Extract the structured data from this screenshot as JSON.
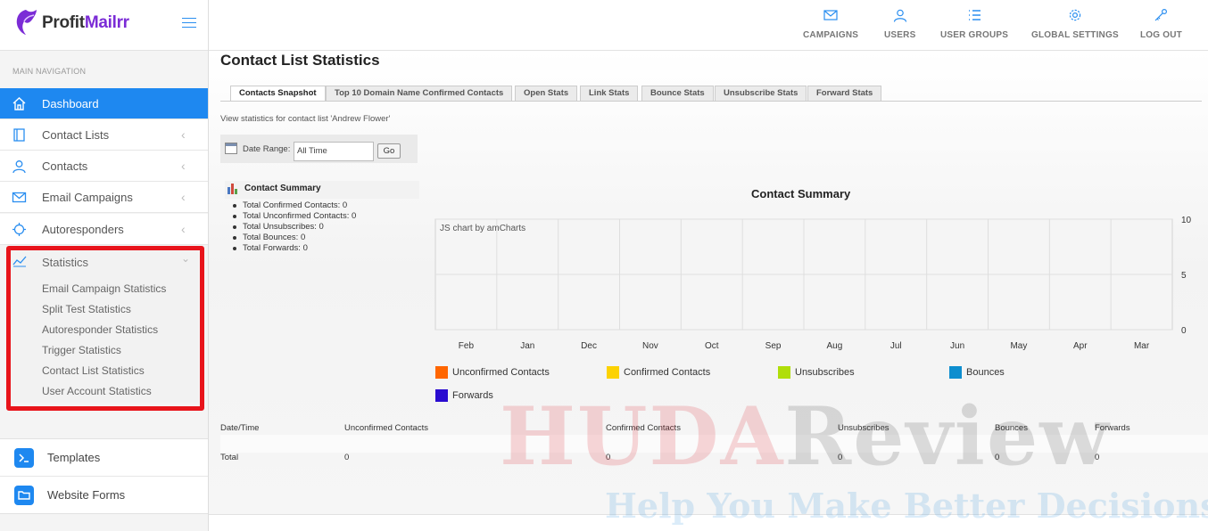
{
  "brand": {
    "part1": "Profit",
    "part2": "Mailrr"
  },
  "sidebar": {
    "heading": "MAIN NAVIGATION",
    "items": [
      {
        "label": "Dashboard",
        "icon": "home-icon"
      },
      {
        "label": "Contact Lists",
        "icon": "book-icon"
      },
      {
        "label": "Contacts",
        "icon": "user-icon"
      },
      {
        "label": "Email Campaigns",
        "icon": "envelope-icon"
      },
      {
        "label": "Autoresponders",
        "icon": "crosshair-icon"
      }
    ],
    "statistics": {
      "label": "Statistics",
      "icon": "trend-icon",
      "children": [
        "Email Campaign Statistics",
        "Split Test Statistics",
        "Autoresponder Statistics",
        "Trigger Statistics",
        "Contact List Statistics",
        "User Account Statistics"
      ]
    },
    "lower": [
      {
        "label": "Templates",
        "icon": "terminal-icon"
      },
      {
        "label": "Website Forms",
        "icon": "folder-icon"
      }
    ]
  },
  "topnav": [
    {
      "label": "CAMPAIGNS",
      "icon": "envelope-icon"
    },
    {
      "label": "USERS",
      "icon": "user-icon"
    },
    {
      "label": "USER GROUPS",
      "icon": "list-icon"
    },
    {
      "label": "GLOBAL SETTINGS",
      "icon": "gear-icon"
    },
    {
      "label": "LOG OUT",
      "icon": "key-icon"
    }
  ],
  "page": {
    "title": "Contact List Statistics",
    "tabs": [
      "Contacts Snapshot",
      "Top 10 Domain Name Confirmed Contacts",
      "Open Stats",
      "Link Stats",
      "Bounce Stats",
      "Unsubscribe Stats",
      "Forward Stats"
    ],
    "description": "View statistics for contact list 'Andrew Flower'",
    "date_range": {
      "label": "Date Range:",
      "value": "All Time",
      "button": "Go"
    },
    "summary": {
      "title": "Contact Summary",
      "items": [
        "Total Confirmed Contacts: 0",
        "Total Unconfirmed Contacts: 0",
        "Total Unsubscribes: 0",
        "Total Bounces: 0",
        "Total Forwards: 0"
      ]
    },
    "table": {
      "headers": [
        "Date/Time",
        "Unconfirmed Contacts",
        "Confirmed Contacts",
        "Unsubscribes",
        "Bounces",
        "Forwards"
      ],
      "total_row": [
        "Total",
        "0",
        "0",
        "0",
        "0",
        "0"
      ]
    }
  },
  "chart_data": {
    "type": "bar",
    "title": "Contact Summary",
    "credit": "JS chart by amCharts",
    "categories": [
      "Feb",
      "Jan",
      "Dec",
      "Nov",
      "Oct",
      "Sep",
      "Aug",
      "Jul",
      "Jun",
      "May",
      "Apr",
      "Mar"
    ],
    "y_ticks": [
      "10",
      "5",
      "0"
    ],
    "ylim": [
      0,
      10
    ],
    "grid": true,
    "legend_position": "bottom",
    "series": [
      {
        "name": "Unconfirmed Contacts",
        "color": "#ff6600",
        "values": [
          0,
          0,
          0,
          0,
          0,
          0,
          0,
          0,
          0,
          0,
          0,
          0
        ]
      },
      {
        "name": "Confirmed Contacts",
        "color": "#fcd202",
        "values": [
          0,
          0,
          0,
          0,
          0,
          0,
          0,
          0,
          0,
          0,
          0,
          0
        ]
      },
      {
        "name": "Unsubscribes",
        "color": "#b0de09",
        "values": [
          0,
          0,
          0,
          0,
          0,
          0,
          0,
          0,
          0,
          0,
          0,
          0
        ]
      },
      {
        "name": "Bounces",
        "color": "#0d8ecf",
        "values": [
          0,
          0,
          0,
          0,
          0,
          0,
          0,
          0,
          0,
          0,
          0,
          0
        ]
      },
      {
        "name": "Forwards",
        "color": "#2a0cd0",
        "values": [
          0,
          0,
          0,
          0,
          0,
          0,
          0,
          0,
          0,
          0,
          0,
          0
        ]
      }
    ]
  },
  "watermark": {
    "red_part": "HUDA",
    "dark_part": "Review",
    "tagline": "Help You Make Better Decisions"
  }
}
